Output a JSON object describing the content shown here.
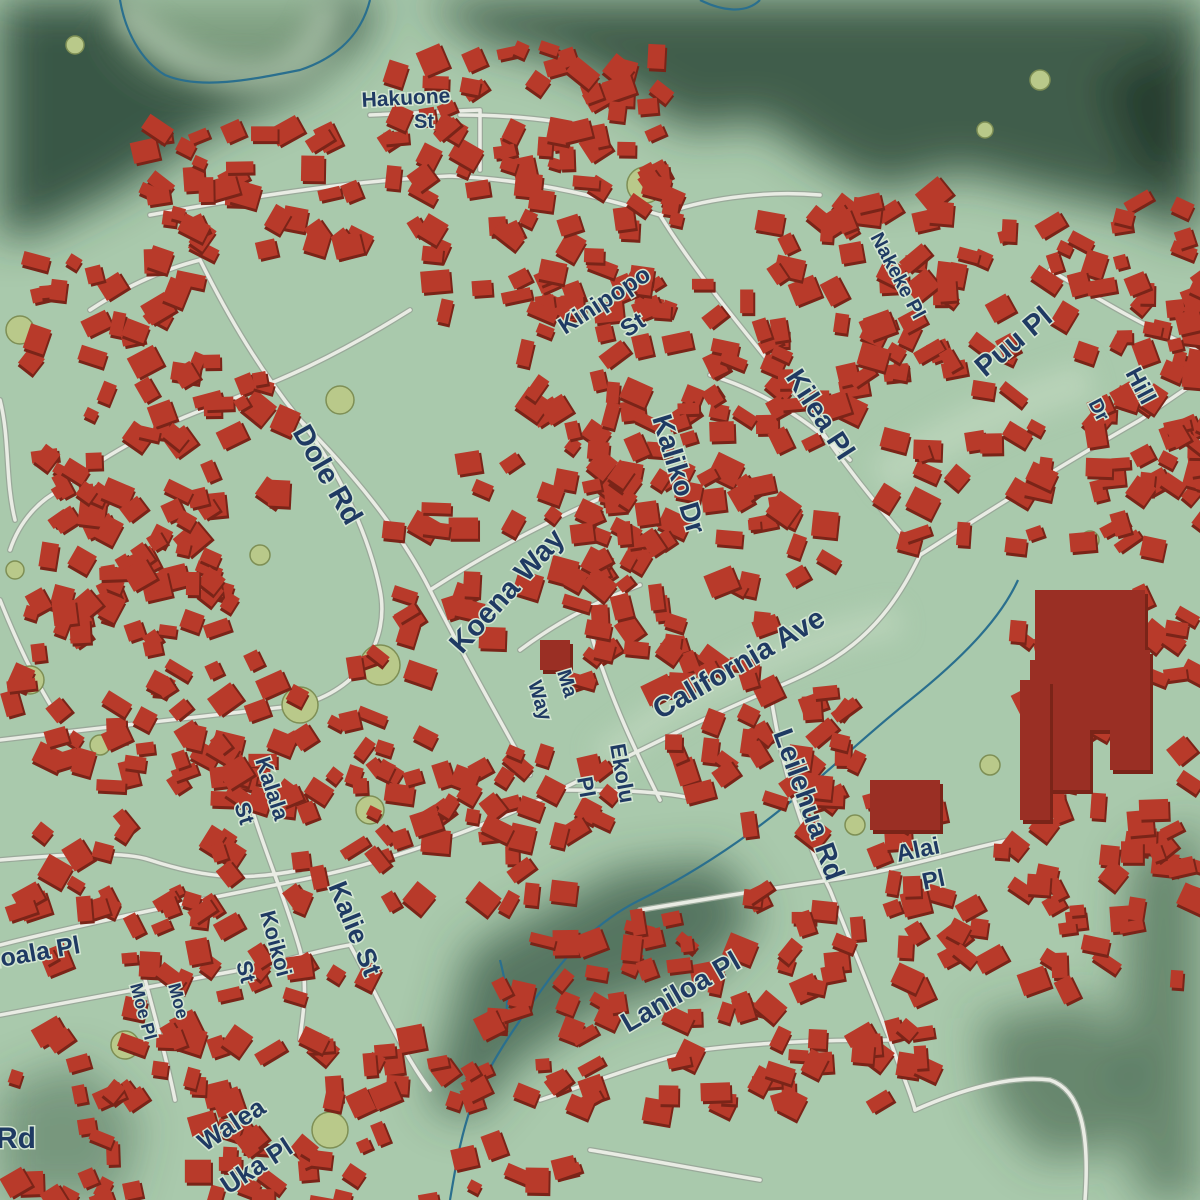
{
  "map": {
    "colors": {
      "land": "#a9c9ac",
      "terrain_dark": "#2f4a3a",
      "building": "#b83a2a",
      "building_dark": "#7a2418",
      "road": "#e9ece4",
      "road_casing": "#9aa99a",
      "stream": "#2a6f8e",
      "label": "#1f3a63",
      "tree": "#b9c98a"
    },
    "labels": {
      "hakuone": "Hakuone",
      "hakuone_st": "St",
      "kinipopo": "Kinipopo",
      "kinipopo_st": "St",
      "nakeke_pl": "Nakeke Pl",
      "puu_pl": "Puu Pl",
      "hill": "Hill",
      "hill_dr": "Dr",
      "kilea_pl": "Kilea Pl",
      "kaliko_dr": "Kaliko Dr",
      "dole_rd": "Dole Rd",
      "koena_way": "Koena Way",
      "california_ave": "California Ave",
      "ma": "Ma",
      "ma_way": "Way",
      "ekolu": "Ekolu",
      "ekolu_pl": "Pl",
      "leilehua_rd": "Leilehua Rd",
      "alai": "Alai",
      "alai_pl": "Pl",
      "kalala": "Kalala",
      "kalala_st": "St",
      "kalie_st": "Kalie St",
      "koikoi": "Koikoi",
      "koikoi_st": "St",
      "loala_pl": "loala Pl",
      "moe": "Moe",
      "moe_pl": "Moe Pl",
      "laniloa_pl": "Laniloa Pl",
      "walea": "Walea",
      "walea_uka_pl": "Uka Pl",
      "rd_edge": "Rd"
    }
  }
}
